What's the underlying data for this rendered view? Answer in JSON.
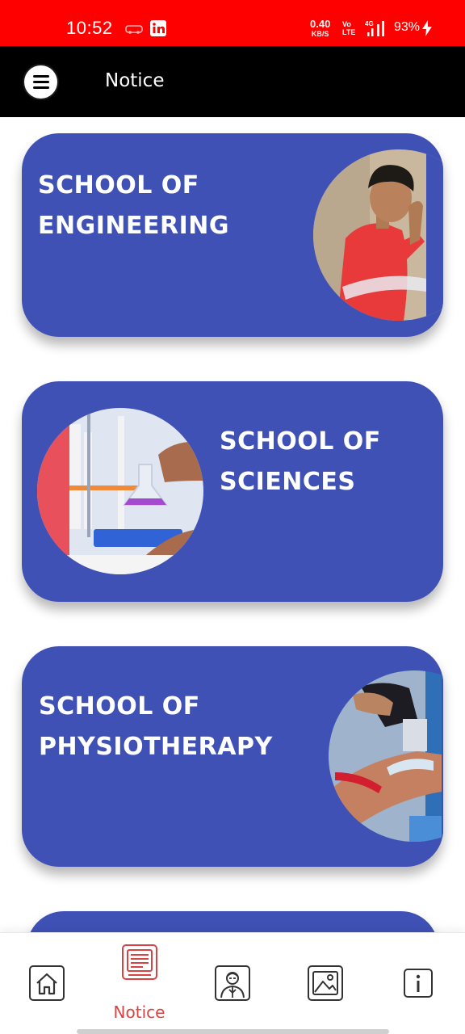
{
  "status_bar": {
    "time": "10:52",
    "net_speed_value": "0.40",
    "net_speed_unit": "KB/S",
    "volte_top": "Vo",
    "volte_bottom": "LTE",
    "network": "4G",
    "battery": "93%",
    "background": "#ff0000"
  },
  "app_bar": {
    "menu_icon": "hamburger-menu-icon",
    "title": "Notice"
  },
  "schools": [
    {
      "title_line1": "SCHOOL OF",
      "title_line2": "ENGINEERING"
    },
    {
      "title_line1": "SCHOOL OF",
      "title_line2": "SCIENCES"
    },
    {
      "title_line1": "SCHOOL OF",
      "title_line2": "PHYSIOTHERAPY"
    }
  ],
  "colors": {
    "card": "#3f51b5",
    "app_bar": "#000000",
    "nav_active": "#d84343"
  },
  "bottom_nav": {
    "items": [
      {
        "icon": "home-icon"
      },
      {
        "icon": "notice-board-icon",
        "label": "Notice",
        "active": true
      },
      {
        "icon": "faculty-icon"
      },
      {
        "icon": "gallery-icon"
      },
      {
        "icon": "info-icon"
      }
    ]
  }
}
